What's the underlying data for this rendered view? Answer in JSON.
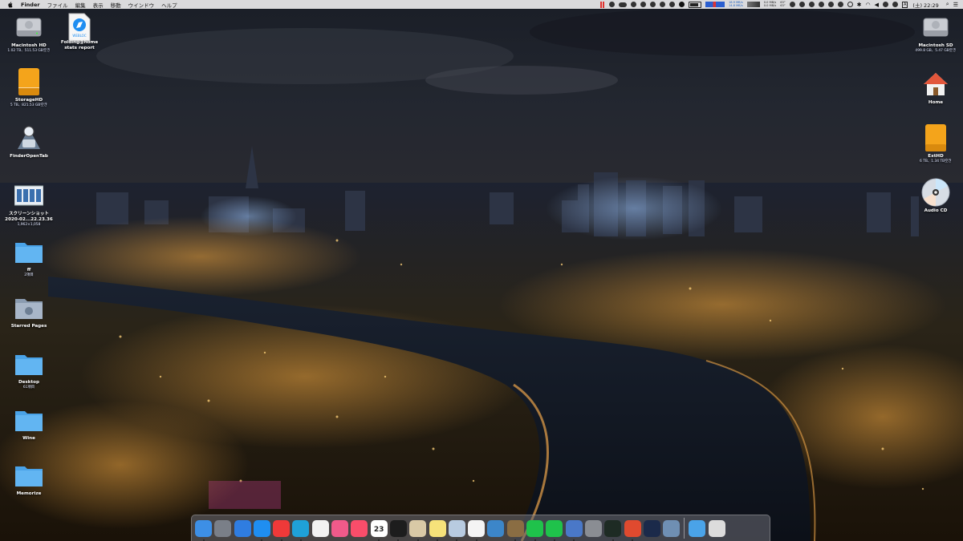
{
  "menubar": {
    "app_name": "Finder",
    "menus": [
      "ファイル",
      "編集",
      "表示",
      "移動",
      "ウインドウ",
      "ヘルプ"
    ],
    "net_up": "18.9 MB/s",
    "net_down": "14.8 MB/s",
    "net2_up": "0.0 MB/s",
    "net2_down": "0.0 MB/s",
    "temp1": "63°",
    "temp2": "63°",
    "clock": "(土) 22:29"
  },
  "desktop_left": [
    {
      "label": "Macintosh HD",
      "sub": "1.02 TB、511.53 GB空き",
      "icon": "internal-disk-icon"
    },
    {
      "label": "StorageHD",
      "sub": "5 TB、821.53 GB空き",
      "icon": "external-disk-icon"
    },
    {
      "label": "FinderOpenTab",
      "sub": "",
      "icon": "automator-app-icon"
    },
    {
      "label": "スクリーンショット 2020-02...22.23.36",
      "sub": "1,962×1,058",
      "icon": "screenshot-thumbnail-icon"
    },
    {
      "label": "ff",
      "sub": "2項目",
      "icon": "folder-icon"
    },
    {
      "label": "Starred Pages",
      "sub": "",
      "icon": "folder-icon"
    },
    {
      "label": "Desktop",
      "sub": "61項目",
      "icon": "folder-icon"
    },
    {
      "label": "Wine",
      "sub": "",
      "icon": "folder-icon"
    },
    {
      "label": "Memorize",
      "sub": "",
      "icon": "folder-icon"
    }
  ],
  "desktop_second": {
    "label": "Folding@home stats report",
    "badge": "WEBLOC",
    "icon": "webloc-file-icon"
  },
  "desktop_right": [
    {
      "label": "Macintosh SD",
      "sub": "499.8 GB、5.47 GB空き",
      "icon": "internal-disk-icon"
    },
    {
      "label": "Home",
      "sub": "",
      "icon": "home-icon"
    },
    {
      "label": "ExtHD",
      "sub": "6 TB、1.34 TB空き",
      "icon": "external-disk-icon"
    },
    {
      "label": "Audio CD",
      "sub": "",
      "icon": "cd-icon"
    }
  ],
  "dock": {
    "calendar_day": "23",
    "apps": [
      {
        "name": "finder-icon",
        "color": "#3d8fe6"
      },
      {
        "name": "launchpad-icon",
        "color": "#7a7f88"
      },
      {
        "name": "mission-control-icon",
        "color": "#2f7de1"
      },
      {
        "name": "safari-icon",
        "color": "#1f8ef1"
      },
      {
        "name": "vivaldi-icon",
        "color": "#ef3939"
      },
      {
        "name": "edge-icon",
        "color": "#1fa1d8"
      },
      {
        "name": "photos-icon",
        "color": "#f2f2f2"
      },
      {
        "name": "itunes-icon",
        "color": "#f05a8a"
      },
      {
        "name": "music-icon",
        "color": "#fa4d6a"
      },
      {
        "name": "calendar-icon",
        "color": "#ffffff"
      },
      {
        "name": "terminal-icon",
        "color": "#1d1d1d"
      },
      {
        "name": "script-editor-icon",
        "color": "#d9c9a6"
      },
      {
        "name": "notes-icon",
        "color": "#f6e27a"
      },
      {
        "name": "preview-icon",
        "color": "#b8cbe0"
      },
      {
        "name": "textedit-icon",
        "color": "#f4f4f4"
      },
      {
        "name": "photo-slideshow-icon",
        "color": "#3c86c9"
      },
      {
        "name": "automator-icon",
        "color": "#8a6d43"
      },
      {
        "name": "line-icon",
        "color": "#1fc24b"
      },
      {
        "name": "line-icon",
        "color": "#1fc24b"
      },
      {
        "name": "screen-sharing-icon",
        "color": "#4a78c8"
      },
      {
        "name": "system-preferences-icon",
        "color": "#8a8d93"
      },
      {
        "name": "activity-monitor-icon",
        "color": "#1e2b24"
      },
      {
        "name": "git-icon",
        "color": "#e04a2f"
      },
      {
        "name": "quicktime-icon",
        "color": "#1b2a4a"
      },
      {
        "name": "image-capture-icon",
        "color": "#6f8fb3"
      }
    ],
    "right": [
      {
        "name": "downloads-folder-icon",
        "color": "#4aa3e8"
      },
      {
        "name": "trash-icon",
        "color": "#dcdcdc"
      }
    ]
  }
}
